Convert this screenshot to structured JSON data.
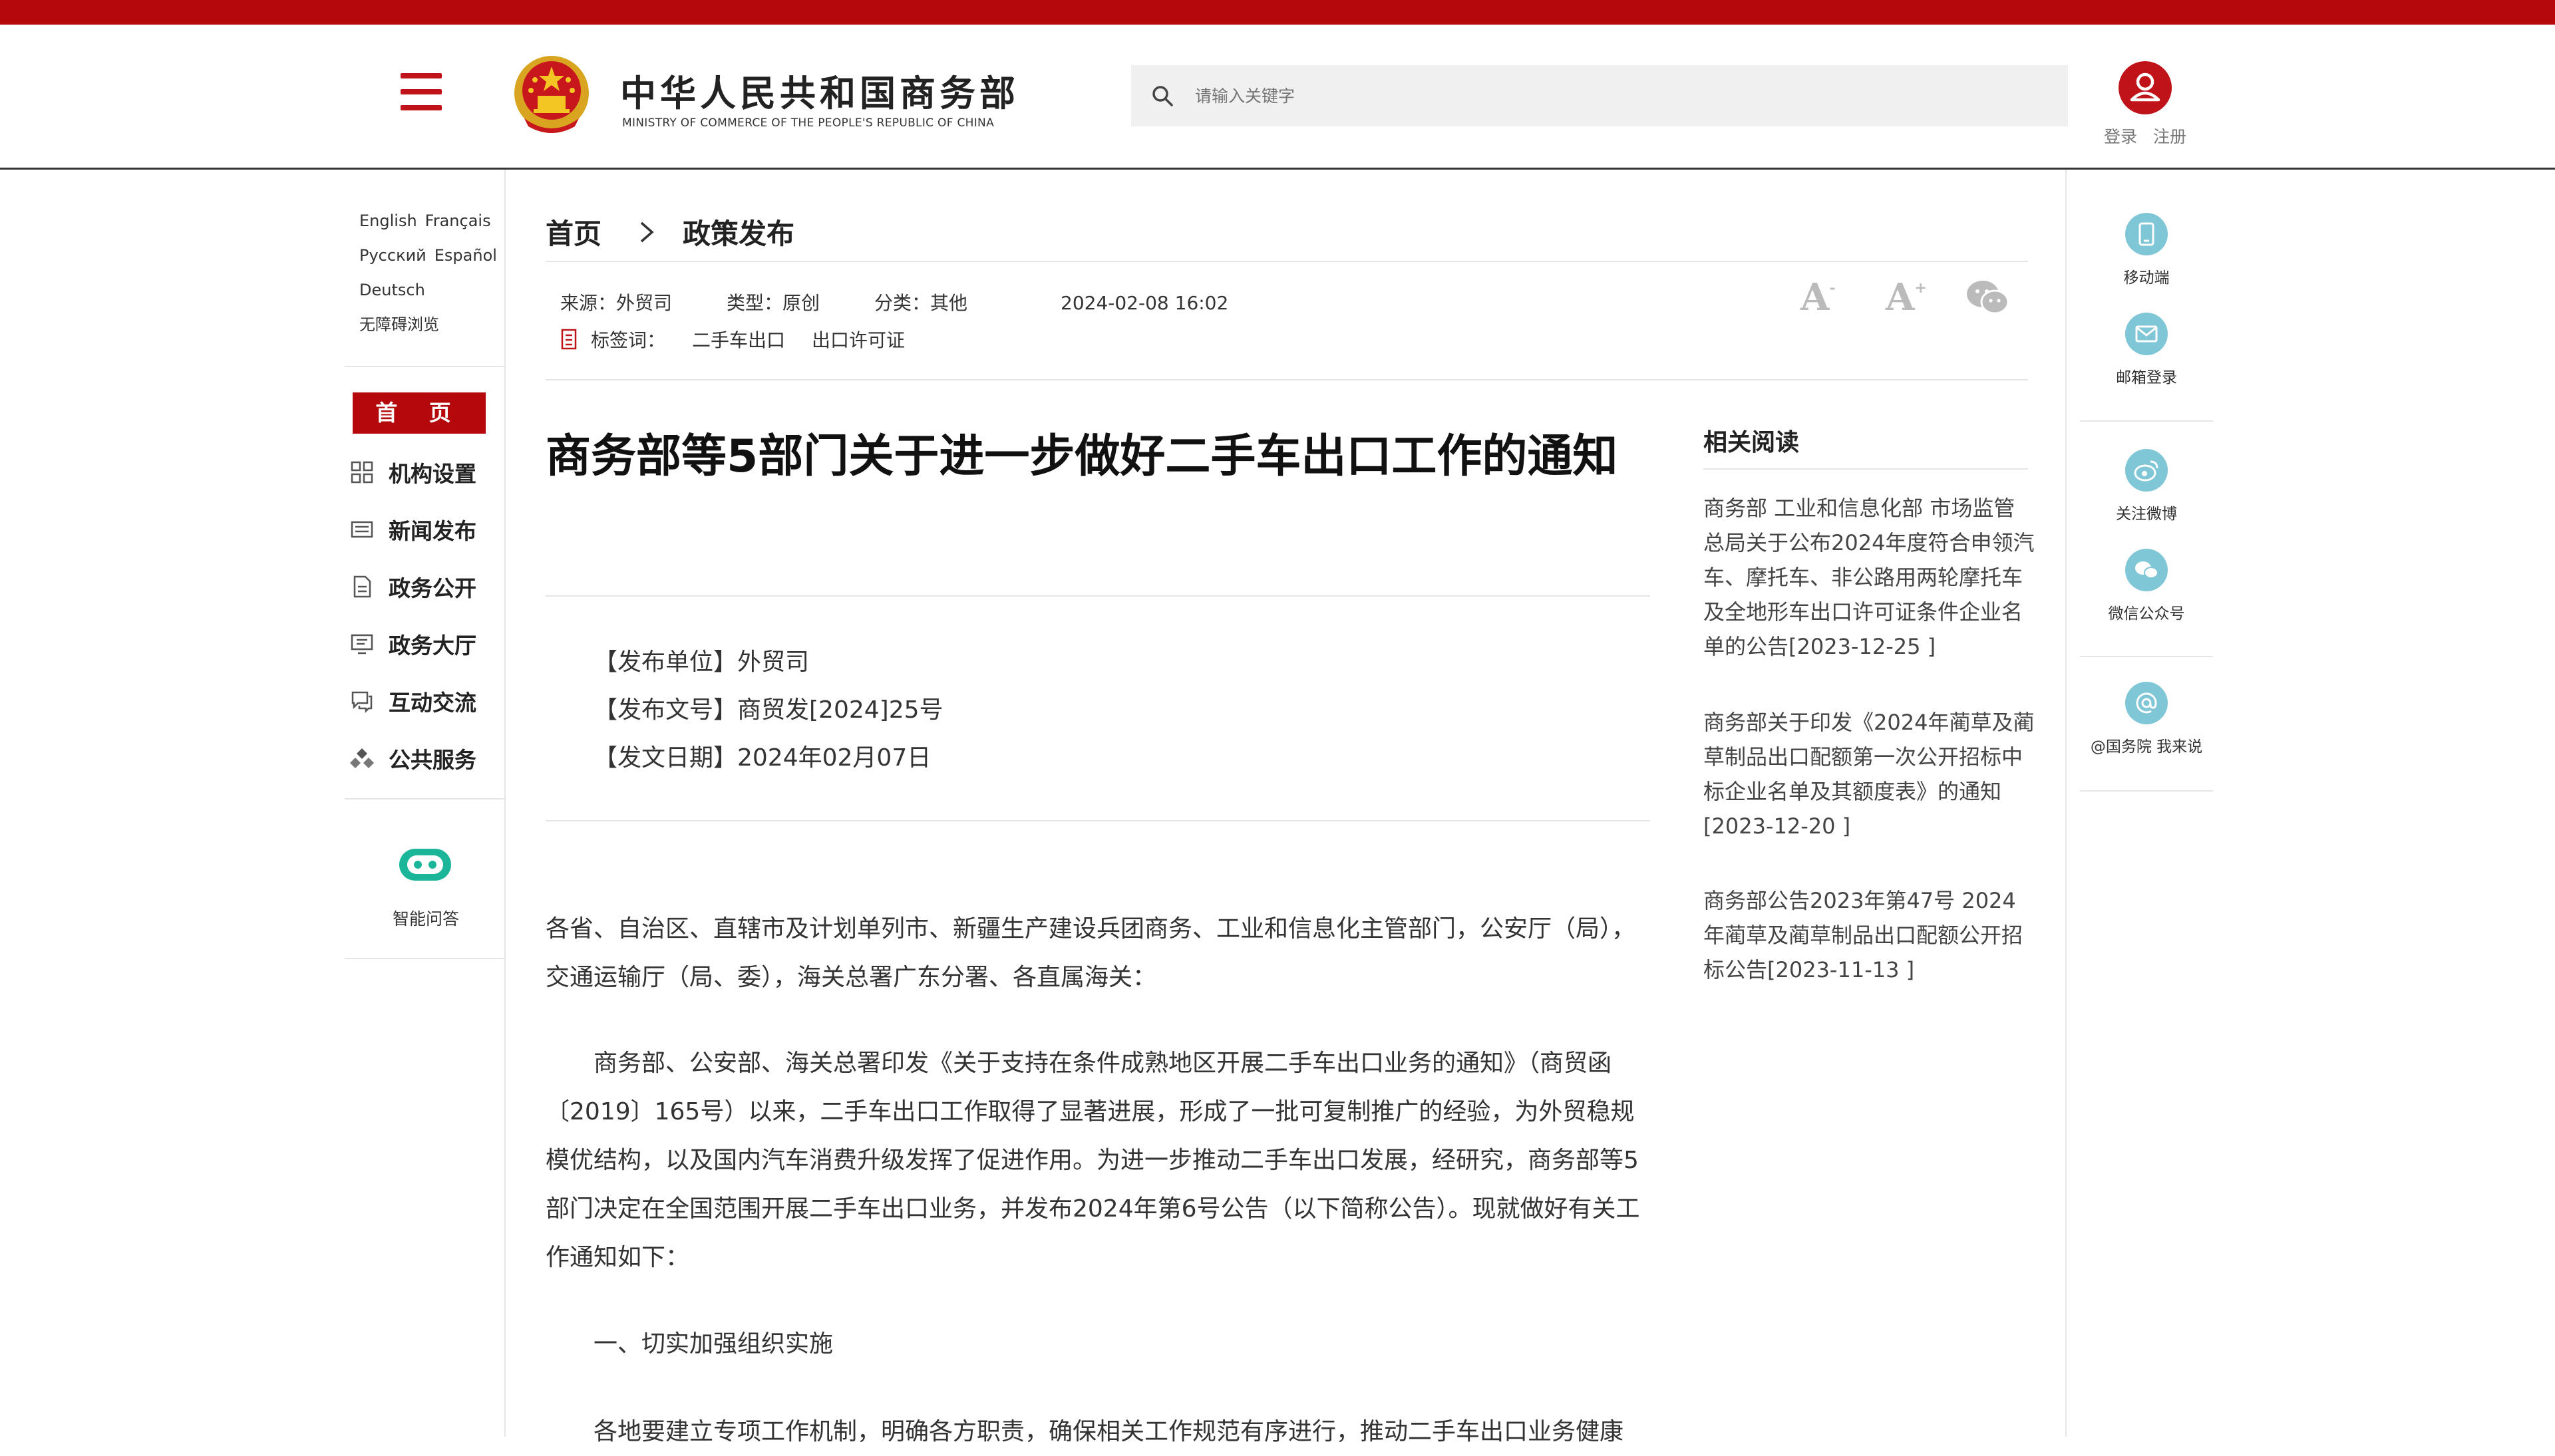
{
  "header": {
    "site_title": "中华人民共和国商务部",
    "site_subtitle": "MINISTRY OF COMMERCE OF THE PEOPLE'S REPUBLIC OF CHINA",
    "search_placeholder": "请输入关键字",
    "login": "登录",
    "register": "注册"
  },
  "sidebar": {
    "languages": [
      "English",
      "Français",
      "Русский",
      "Español",
      "Deutsch"
    ],
    "accessibility": "无障碍浏览",
    "home": "首 页",
    "nav": [
      "机构设置",
      "新闻发布",
      "政务公开",
      "政务大厅",
      "互动交流",
      "公共服务"
    ],
    "assistant": "智能问答"
  },
  "breadcrumb": {
    "home": "首页",
    "current": "政策发布"
  },
  "meta": {
    "source": "来源：外贸司",
    "type": "类型：原创",
    "category": "分类：其他",
    "date": "2024-02-08 16:02",
    "tags_label": "标签词：",
    "tags": [
      "二手车出口",
      "出口许可证"
    ],
    "font_small": "A",
    "font_large": "A",
    "font_small_sup": "-",
    "font_large_sup": "+"
  },
  "article": {
    "title": "商务部等5部门关于进一步做好二手车出口工作的通知",
    "issuer": "【发布单位】外贸司",
    "doc_no": "【发布文号】商贸发[2024]25号",
    "issue_date": "【发文日期】2024年02月07日",
    "paragraphs": [
      "各省、自治区、直辖市及计划单列市、新疆生产建设兵团商务、工业和信息化主管部门，公安厅（局），交通运输厅（局、委），海关总署广东分署、各直属海关：",
      "商务部、公安部、海关总署印发《关于支持在条件成熟地区开展二手车出口业务的通知》（商贸函〔2019〕165号）以来，二手车出口工作取得了显著进展，形成了一批可复制推广的经验，为外贸稳规模优结构，以及国内汽车消费升级发挥了促进作用。为进一步推动二手车出口发展，经研究，商务部等5部门决定在全国范围开展二手车出口业务，并发布2024年第6号公告（以下简称公告）。现就做好有关工作通知如下：",
      "一、切实加强组织实施",
      "各地要建立专项工作机制，明确各方职责，确保相关工作规范有序进行，推动二手车出口业务健康"
    ]
  },
  "related": {
    "title": "相关阅读",
    "items": [
      "商务部 工业和信息化部 市场监管总局关于公布2024年度符合申领汽车、摩托车、非公路用两轮摩托车及全地形车出口许可证条件企业名单的公告[2023-12-25 ]",
      "商务部关于印发《2024年蔺草及蔺草制品出口配额第一次公开招标中标企业名单及其额度表》的通知[2023-12-20 ]",
      "商务部公告2023年第47号 2024年蔺草及蔺草制品出口配额公开招标公告[2023-11-13 ]"
    ]
  },
  "share": {
    "mobile": "移动端",
    "mail": "邮箱登录",
    "weibo": "关注微博",
    "wechat": "微信公众号",
    "gov": "@国务院 我来说"
  },
  "colors": {
    "brand_red": "#b5080d",
    "share_blue": "#7fc6d6"
  }
}
